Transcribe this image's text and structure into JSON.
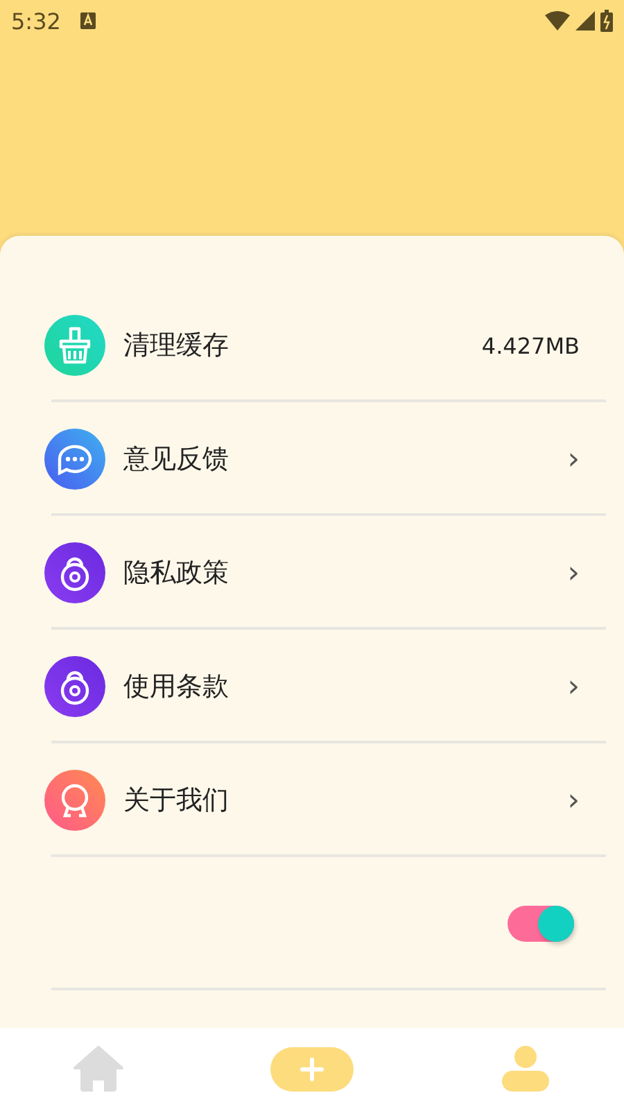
{
  "status_bar": {
    "time": "5:32"
  },
  "items": [
    {
      "kind": "value",
      "label": "清理缓存",
      "value": "4.427MB"
    },
    {
      "kind": "link",
      "label": "意见反馈",
      "arrow": "›"
    },
    {
      "kind": "link",
      "label": "隐私政策",
      "arrow": "›"
    },
    {
      "kind": "link",
      "label": "使用条款",
      "arrow": "›"
    },
    {
      "kind": "link",
      "label": "关于我们",
      "arrow": "›"
    }
  ],
  "toggle": {
    "on": true
  },
  "nav": [
    {
      "selected": false
    },
    {
      "selected": true
    },
    {
      "selected": true
    }
  ]
}
